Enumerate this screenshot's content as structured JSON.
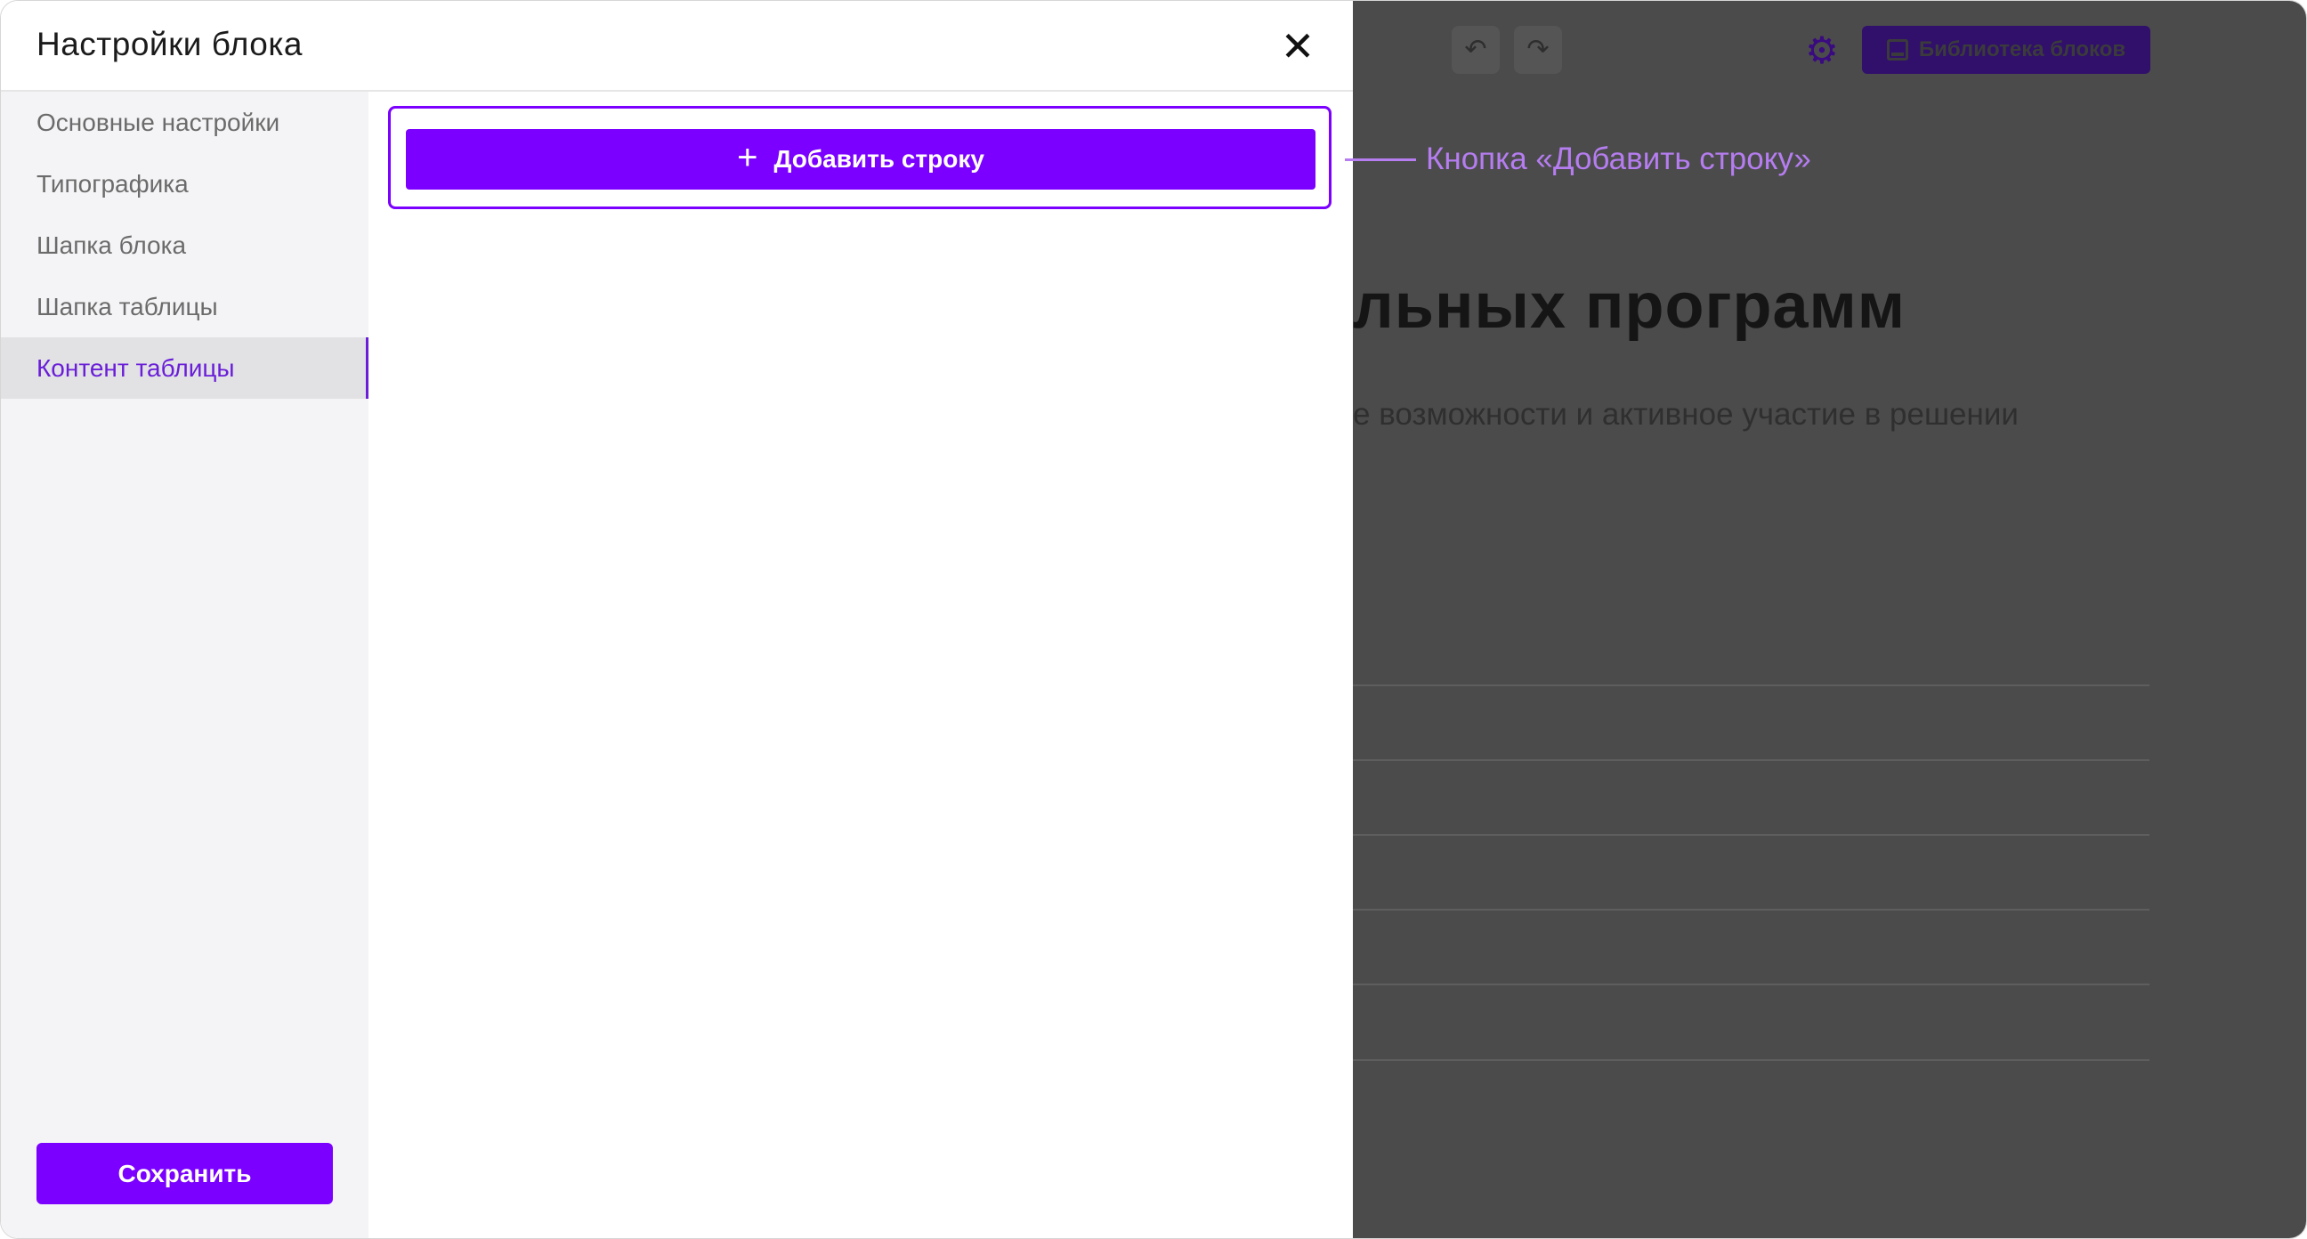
{
  "modal": {
    "title": "Настройки блока",
    "close_icon": "close-icon"
  },
  "sidebar": {
    "items": [
      {
        "label": "Основные настройки",
        "active": false
      },
      {
        "label": "Типографика",
        "active": false
      },
      {
        "label": "Шапка блока",
        "active": false
      },
      {
        "label": "Шапка таблицы",
        "active": false
      },
      {
        "label": "Контент таблицы",
        "active": true
      }
    ],
    "save_label": "Сохранить"
  },
  "content": {
    "add_row_label": "Добавить строку",
    "add_row_icon": "plus-icon"
  },
  "annotation": {
    "callout_text": "Кнопка «Добавить строку»"
  },
  "background_page": {
    "toolbar": {
      "undo_icon": "undo-icon",
      "redo_icon": "redo-icon",
      "settings_icon": "gear-icon",
      "library_label": "Библиотека блоков",
      "library_icon": "image-icon"
    },
    "title_fragment": "льных программ",
    "subtitle_fragment": "е возможности и активное участие в решении"
  },
  "colors": {
    "accent": "#7b00ff",
    "active_text": "#6a1ed8",
    "callout": "#b57df0",
    "overlay": "#4b4b4b"
  }
}
